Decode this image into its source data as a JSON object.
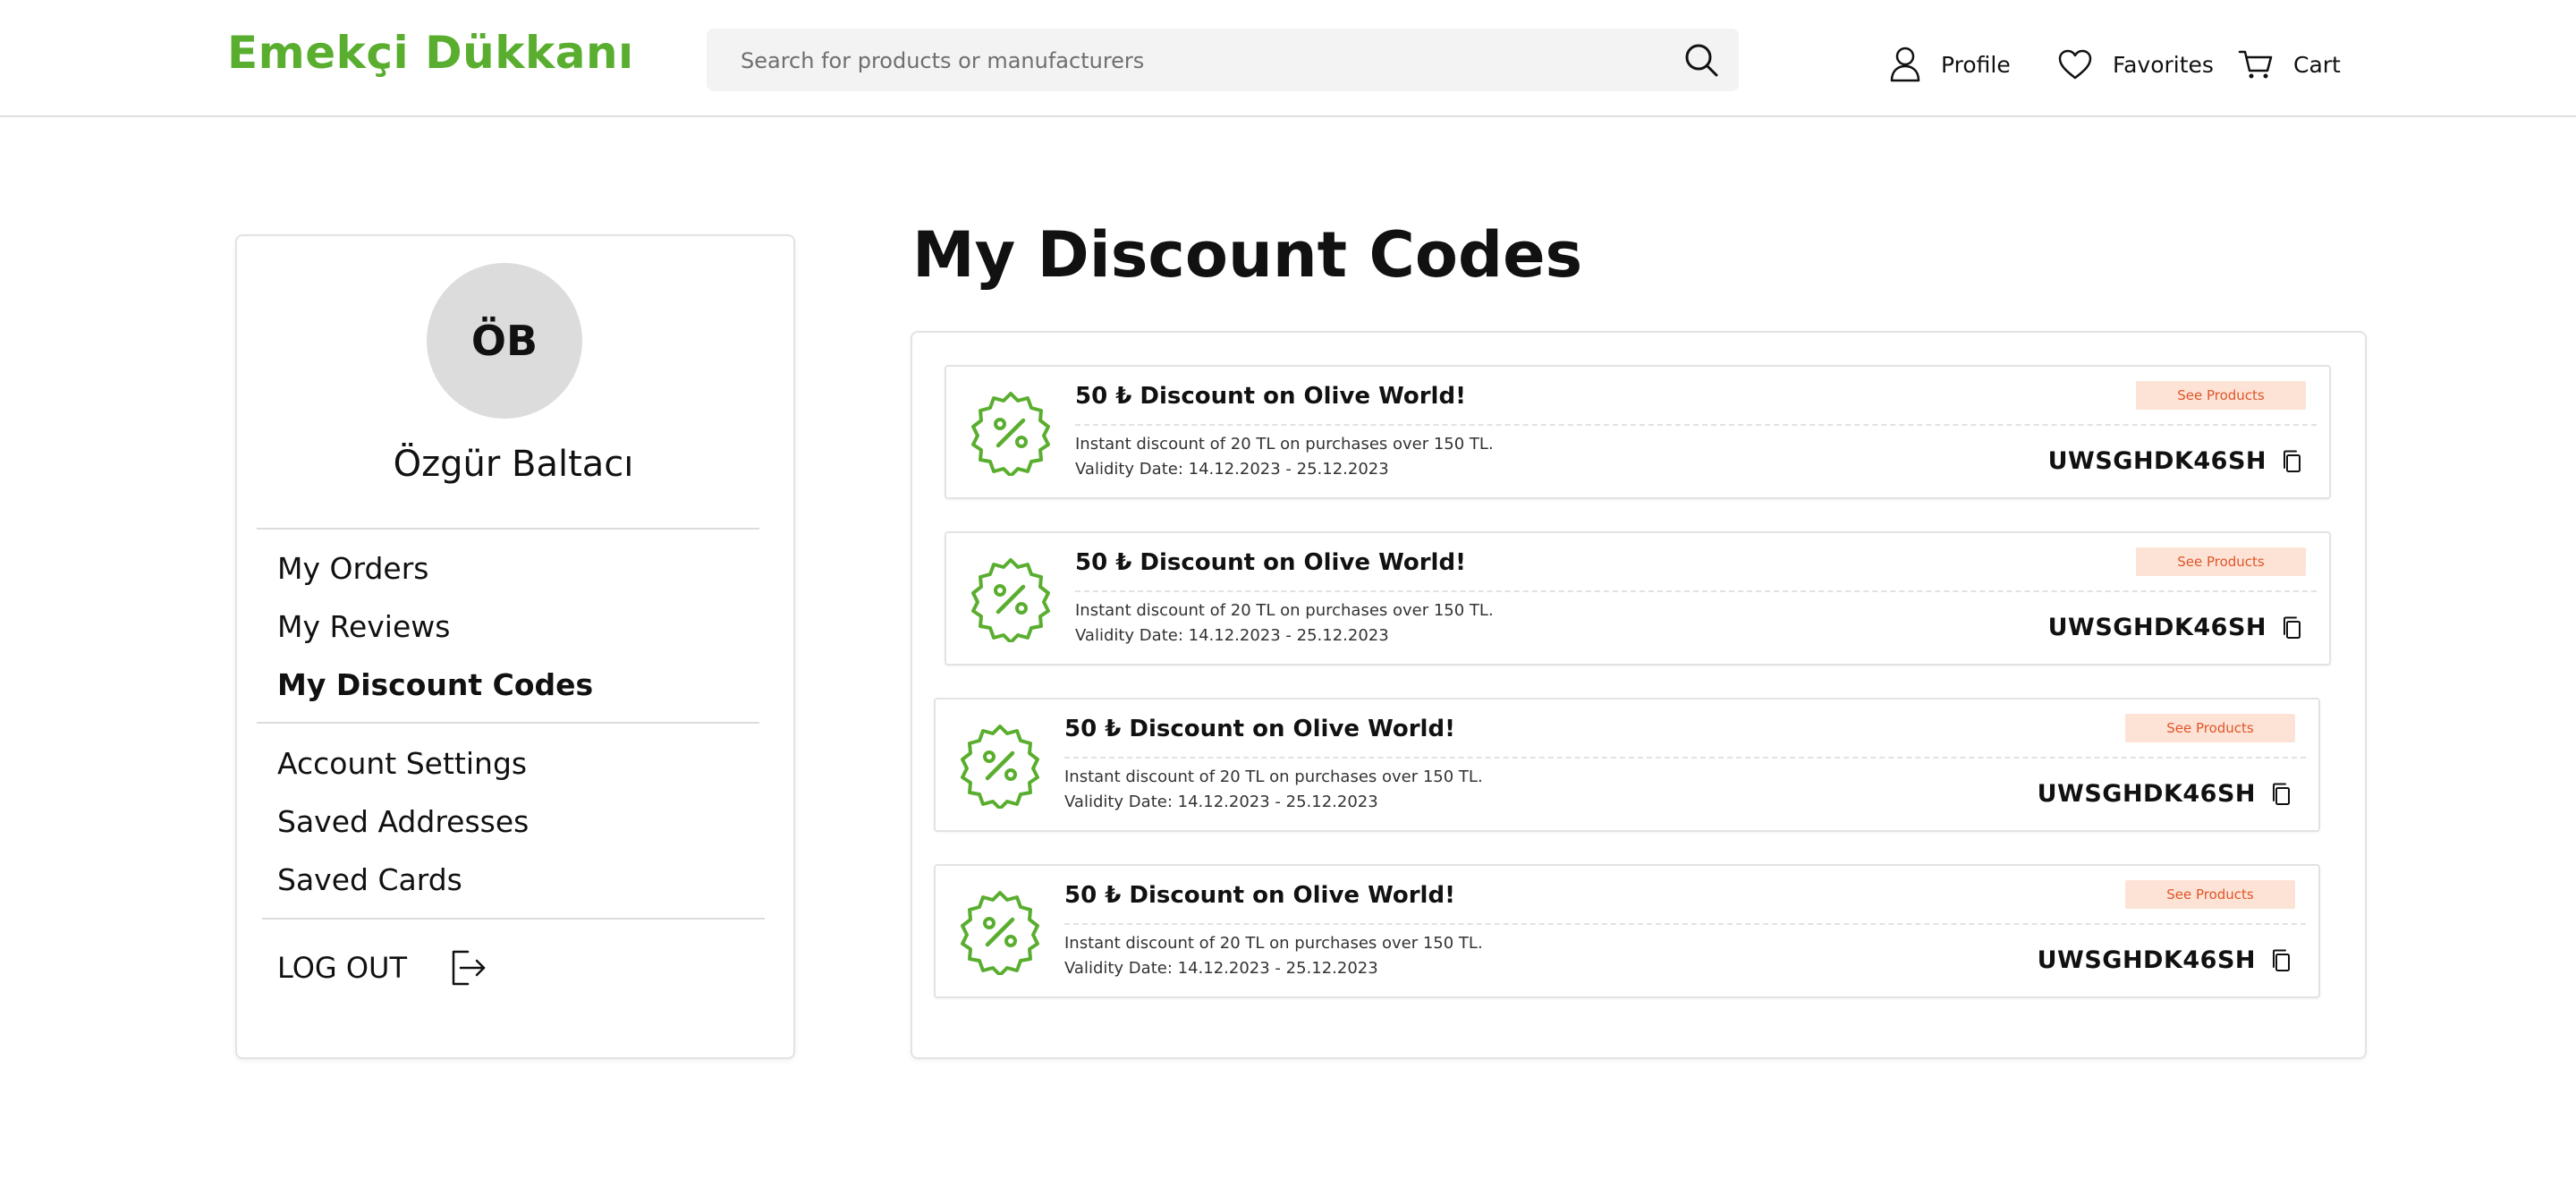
{
  "header": {
    "logo": "Emekçi Dükkanı",
    "search_placeholder": "Search for products or manufacturers",
    "nav": {
      "profile": "Profile",
      "favorites": "Favorites",
      "cart": "Cart"
    }
  },
  "sidebar": {
    "avatar_initials": "ÖB",
    "user_name": "Özgür Baltacı",
    "menu_group_1": [
      "My Orders",
      "My Reviews",
      "My Discount Codes"
    ],
    "menu_group_2": [
      "Account Settings",
      "Saved Addresses",
      "Saved Cards"
    ],
    "active_item": "My Discount Codes",
    "logout": "LOG OUT"
  },
  "main": {
    "title": "My Discount Codes",
    "coupons": [
      {
        "title": "50 ₺ Discount on Olive World!",
        "description": "Instant discount of 20 TL on purchases over 150 TL.",
        "validity": "Validity Date: 14.12.2023 - 25.12.2023",
        "button": "See Products",
        "code": "UWSGHDK46SH"
      },
      {
        "title": "50 ₺ Discount on Olive World!",
        "description": "Instant discount of 20 TL on purchases over 150 TL.",
        "validity": "Validity Date: 14.12.2023 - 25.12.2023",
        "button": "See Products",
        "code": "UWSGHDK46SH"
      },
      {
        "title": "50 ₺ Discount on Olive World!",
        "description": "Instant discount of 20 TL on purchases over 150 TL.",
        "validity": "Validity Date: 14.12.2023 - 25.12.2023",
        "button": "See Products",
        "code": "UWSGHDK46SH"
      },
      {
        "title": "50 ₺ Discount on Olive World!",
        "description": "Instant discount of 20 TL on purchases over 150 TL.",
        "validity": "Validity Date: 14.12.2023 - 25.12.2023",
        "button": "See Products",
        "code": "UWSGHDK46SH"
      }
    ]
  },
  "icons": {
    "search": "search-icon",
    "profile": "user-icon",
    "favorites": "heart-icon",
    "cart": "cart-icon",
    "coupon": "discount-badge-icon",
    "copy": "copy-icon",
    "logout": "logout-icon"
  },
  "colors": {
    "brand": "#5aae2f",
    "accent_button_bg": "#fde3d6",
    "accent_button_text": "#e0552a"
  }
}
